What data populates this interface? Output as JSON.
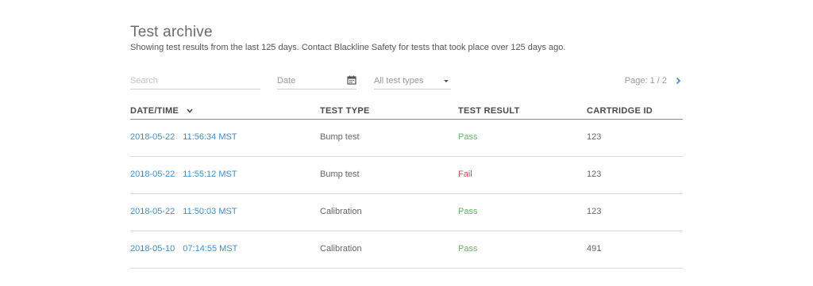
{
  "header": {
    "title": "Test archive",
    "subtitle": "Showing test results from the last 125 days. Contact Blackline Safety for tests that took place over 125 days ago."
  },
  "filters": {
    "search_placeholder": "Search",
    "date_label": "Date",
    "date_icon": "calendar-icon",
    "type_label": "All test types",
    "type_icon": "caret-down-icon"
  },
  "pagination": {
    "text": "Page: 1 / 2",
    "next_icon": "chevron-right-icon"
  },
  "table": {
    "columns": [
      "DATE/TIME",
      "TEST TYPE",
      "TEST RESULT",
      "CARTRIDGE ID"
    ],
    "sort_icon": "chevron-down-icon",
    "rows": [
      {
        "date": "2018-05-22",
        "time": "11:56:34 MST",
        "type": "Bump test",
        "result": "Pass",
        "cartridge": "123"
      },
      {
        "date": "2018-05-22",
        "time": "11:55:12 MST",
        "type": "Bump test",
        "result": "Fail",
        "cartridge": "123"
      },
      {
        "date": "2018-05-22",
        "time": "11:50:03 MST",
        "type": "Calibration",
        "result": "Pass",
        "cartridge": "123"
      },
      {
        "date": "2018-05-10",
        "time": "07:14:55 MST",
        "type": "Calibration",
        "result": "Pass",
        "cartridge": "491"
      }
    ]
  },
  "colors": {
    "link": "#3f8fc9",
    "pass": "#6ab36a",
    "fail": "#d24b5e"
  }
}
